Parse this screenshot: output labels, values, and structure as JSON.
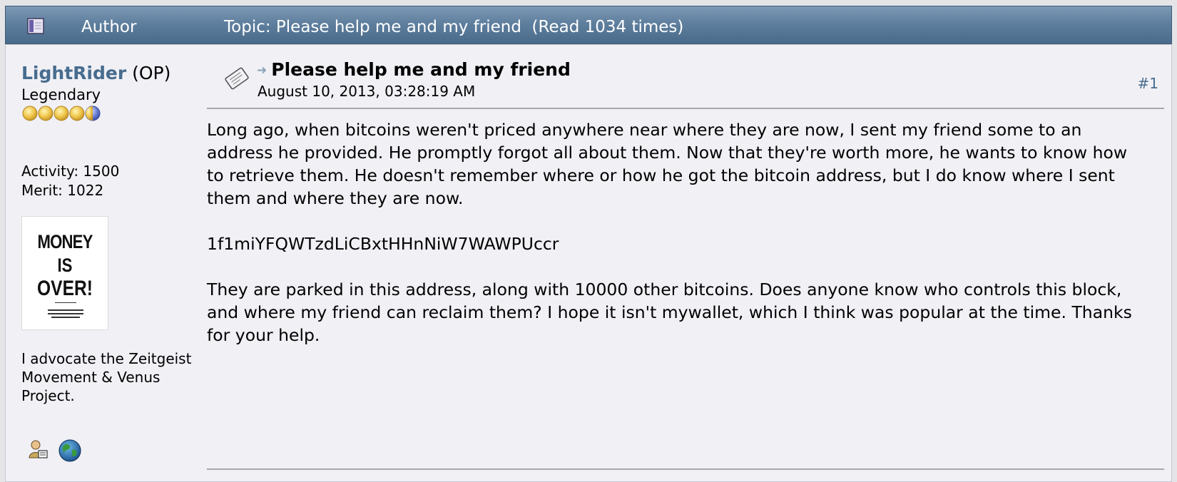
{
  "header": {
    "author_label": "Author",
    "topic_label": "Topic: Please help me and my friend  (Read 1034 times)"
  },
  "poster": {
    "username": "LightRider",
    "op_tag": "(OP)",
    "rank": "Legendary",
    "activity": "Activity: 1500",
    "merit": "Merit: 1022",
    "avatar_text": [
      "MONEY",
      "IS",
      "OVER!"
    ],
    "signature": "I advocate the Zeitgeist Movement & Venus Project.",
    "icons": [
      "profile-icon",
      "globe-icon"
    ]
  },
  "post": {
    "subject": "Please help me and my friend",
    "date": "August 10, 2013, 03:28:19 AM",
    "number": "#1",
    "paragraphs": [
      "Long ago, when bitcoins weren't priced anywhere near where they are now, I sent my friend some to an address he provided. He promptly forgot all about them. Now that they're worth more, he wants to know how to retrieve them. He doesn't remember where or how he got the bitcoin address, but I do know where I sent them and where they are now.",
      "1f1miYFQWTzdLiCBxtHHnNiW7WAWPUccr",
      "They are parked in this address, along with 10000 other bitcoins. Does anyone know who controls this block, and where my friend can reclaim them? I hope it isn't mywallet, which I think was popular at the time. Thanks for your help."
    ]
  },
  "colors": {
    "header_bg": "#5f7f9e",
    "username": "#476c8e",
    "post_bg": "#f0f0f5",
    "page_bg": "#e5e5e8"
  }
}
